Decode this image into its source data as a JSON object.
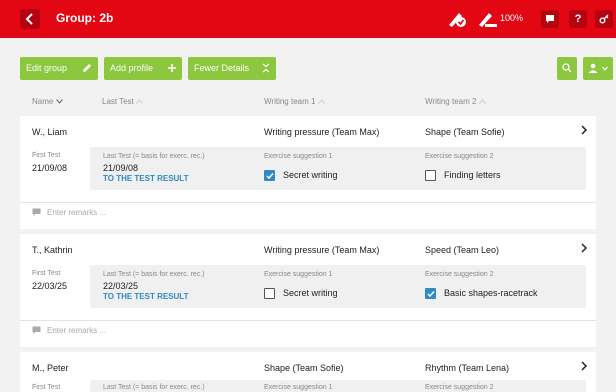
{
  "header": {
    "title": "Group: 2b",
    "zoom": "100%",
    "help_label": "?",
    "colors": {
      "bar": "#e30613",
      "button": "#b5040f"
    }
  },
  "toolbar": {
    "edit_group": "Edit group",
    "add_profile": "Add profile",
    "fewer_details": "Fewer Details",
    "colors": {
      "button": "#8dc63f"
    }
  },
  "columns": {
    "name": "Name",
    "last_test": "Last Test",
    "writing_team_1": "Writing team 1",
    "writing_team_2": "Writing team 2"
  },
  "labels": {
    "first_test": "First Test",
    "last_test_basis": "Last Test (= basis for exerc. rec.)",
    "exercise_1": "Exercise suggestion 1",
    "exercise_2": "Exercise suggestion 2",
    "to_result": "TO THE TEST RESULT",
    "remarks_placeholder": "Enter remarks ...",
    "link_color": "#2e8bc6"
  },
  "students": [
    {
      "name": "W., Liam",
      "team1": "Writing pressure (Team Max)",
      "team2": "Shape (Team Sofie)",
      "first_test": "21/09/08",
      "last_test": "21/09/08",
      "exercise1": {
        "label": "Secret writing",
        "checked": true
      },
      "exercise2": {
        "label": "Finding letters",
        "checked": false
      }
    },
    {
      "name": "T., Kathrin",
      "team1": "Writing pressure (Team Max)",
      "team2": "Speed (Team Leo)",
      "first_test": "22/03/25",
      "last_test": "22/03/25",
      "exercise1": {
        "label": "Secret writing",
        "checked": false
      },
      "exercise2": {
        "label": "Basic shapes-racetrack",
        "checked": true
      }
    },
    {
      "name": "M., Peter",
      "team1": "Shape (Team Sofie)",
      "team2": "Rhythm (Team Lena)",
      "first_test": "",
      "last_test": "",
      "exercise1": {
        "label": "",
        "checked": false
      },
      "exercise2": {
        "label": "",
        "checked": false
      }
    }
  ]
}
